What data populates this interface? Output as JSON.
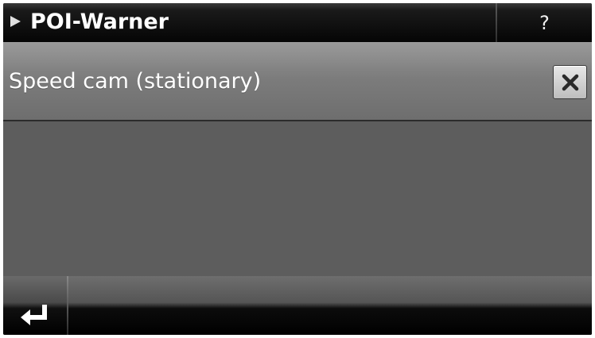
{
  "header": {
    "title": "POI-Warner",
    "help_label": "?"
  },
  "list": {
    "items": [
      {
        "label": "Speed cam (stationary)"
      }
    ]
  },
  "icons": {
    "header_indicator": "play-triangle-icon",
    "delete": "close-icon",
    "back": "return-arrow-icon"
  },
  "colors": {
    "header_bg": "#050505",
    "row_bg": "#7e7e7e",
    "content_bg": "#5d5d5d",
    "text": "#ffffff"
  }
}
